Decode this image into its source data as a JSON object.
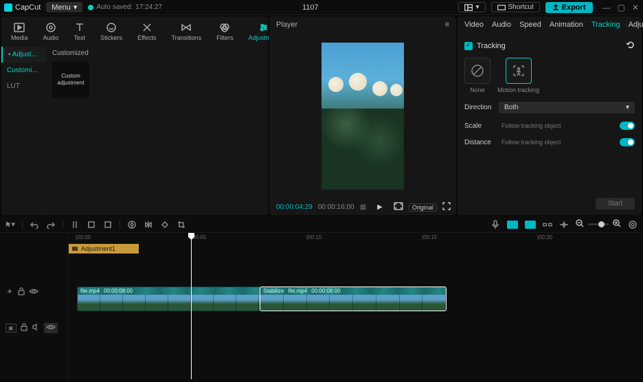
{
  "topbar": {
    "app_name": "CapCut",
    "menu": "Menu",
    "autosave_label": "Auto saved:",
    "autosave_time": "17:24:27",
    "project_title": "1107",
    "shortcut": "Shortcut",
    "export": "Export"
  },
  "asset_tabs": {
    "media": "Media",
    "audio": "Audio",
    "text": "Text",
    "stickers": "Stickers",
    "effects": "Effects",
    "transitions": "Transitions",
    "filters": "Filters",
    "adjustment": "Adjustment"
  },
  "asset_sidebar": {
    "adjustment": "Adjustment",
    "customized": "Customi...",
    "lut": "LUT"
  },
  "asset_content": {
    "heading": "Customized",
    "card": "Custom adjustment"
  },
  "player": {
    "title": "Player",
    "current": "00:00:04;29",
    "total": "00:00:16;00",
    "original": "Original"
  },
  "inspector": {
    "tabs": {
      "video": "Video",
      "audio": "Audio",
      "speed": "Speed",
      "animation": "Animation",
      "tracking": "Tracking",
      "adjustment": "Adjustm..."
    },
    "tracking_label": "Tracking",
    "modes": {
      "none": "None",
      "motion": "Motion tracking"
    },
    "direction_label": "Direction",
    "direction_value": "Both",
    "scale_label": "Scale",
    "scale_hint": "Follow tracking object",
    "distance_label": "Distance",
    "distance_hint": "Follow tracking object",
    "start": "Start"
  },
  "ruler": {
    "t0": "|00:00",
    "t1": "|00:05",
    "t2": "|00:10",
    "t3": "|00:15",
    "t4": "|00:20"
  },
  "clips": {
    "adj": "Adjustment1",
    "v1_name": "file.mp4",
    "v1_dur": "00:00:08:00",
    "v2_tag": "Stabilize",
    "v2_name": "file.mp4",
    "v2_dur": "00:00:08:00"
  }
}
